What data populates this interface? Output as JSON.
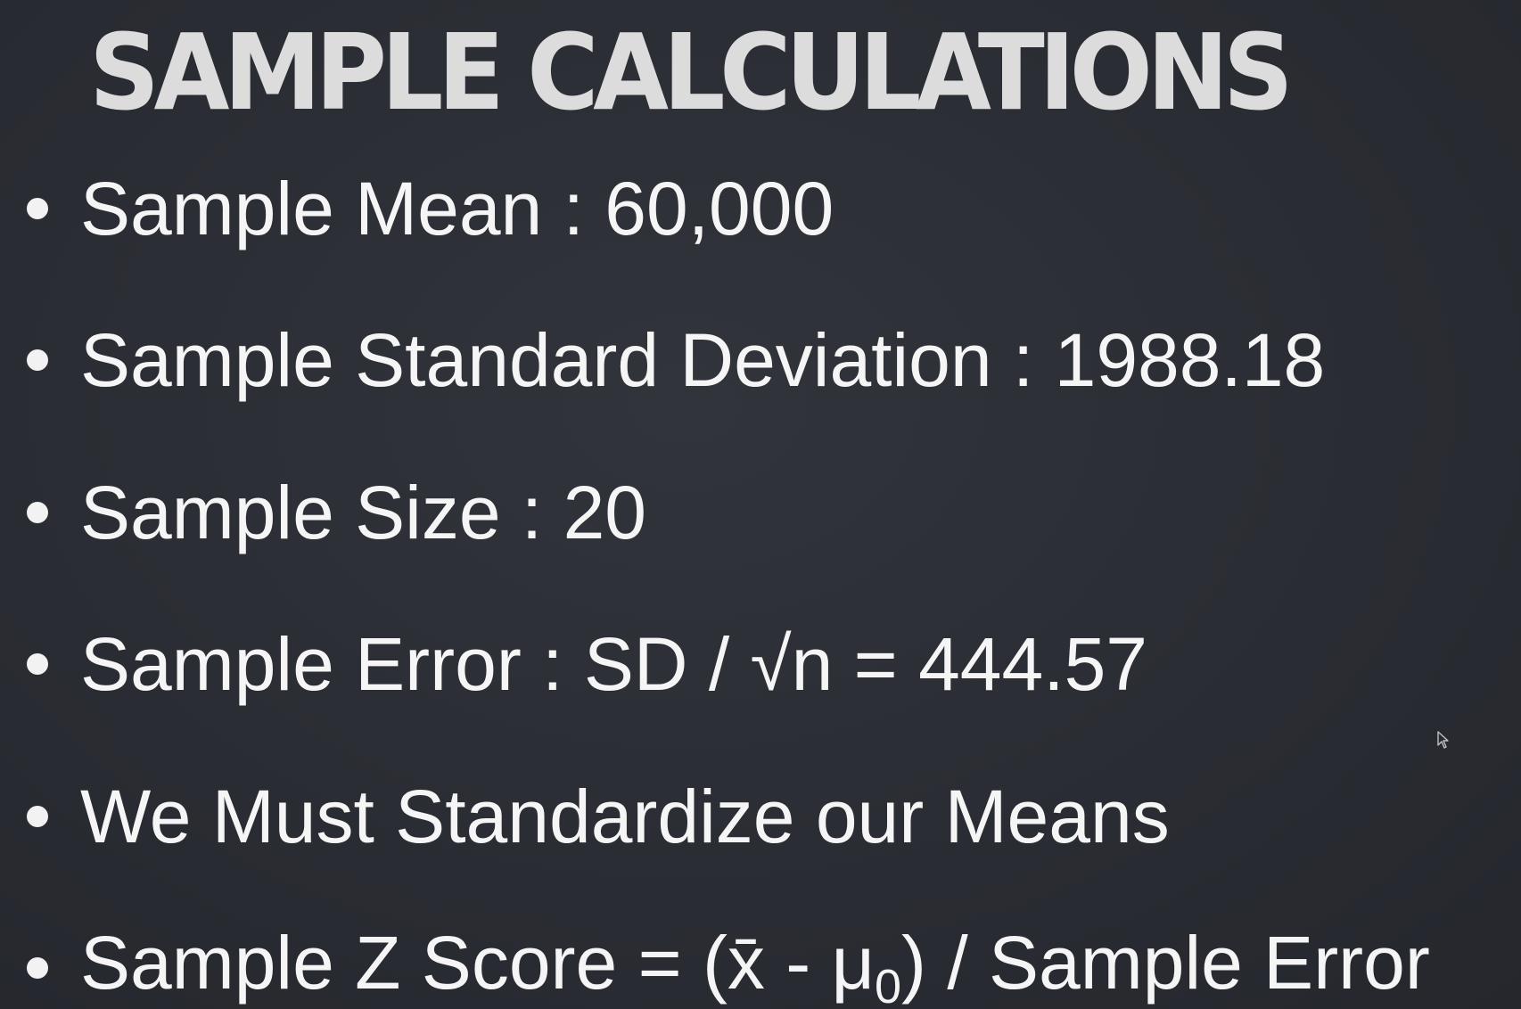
{
  "slide": {
    "title": "SAMPLE CALCULATIONS",
    "bullets": [
      {
        "text": "Sample Mean : 60,000"
      },
      {
        "text": "Sample Standard Deviation : 1988.18"
      },
      {
        "text": "Sample Size : 20"
      },
      {
        "text": "Sample Error : SD / √n = 444.57"
      },
      {
        "text": "We Must Standardize our Means"
      },
      {
        "text_before": "Sample Z Score = (x̄ - μ",
        "subscript": "0",
        "text_after": ") / Sample Error"
      }
    ]
  },
  "colors": {
    "background": "#2b2d34",
    "title": "#dcdcdc",
    "text": "#f5f5f5"
  },
  "icons": {
    "cursor": "mouse-pointer-icon"
  }
}
